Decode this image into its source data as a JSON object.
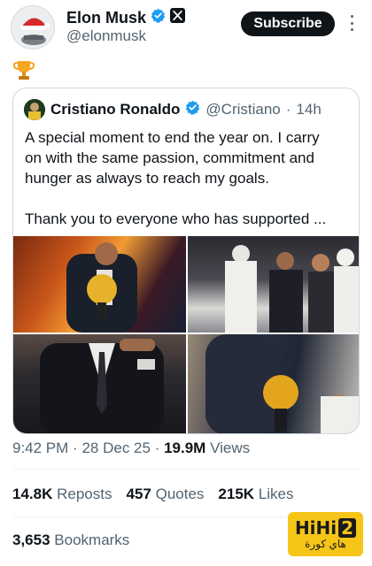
{
  "post": {
    "author_name": "Elon Musk",
    "author_handle": "@elonmusk",
    "subscribe_label": "Subscribe",
    "body_emoji": "trophy-icon"
  },
  "quote": {
    "author_name": "Cristiano Ronaldo",
    "author_handle": "@Cristiano",
    "separator": "·",
    "time": "14h",
    "text_lines": [
      "A special moment to end the year on. I carry",
      "on with the same passion, commitment and",
      "hunger as always to reach my goals.",
      "",
      "Thank you to everyone who has supported ..."
    ]
  },
  "meta": {
    "time": "9:42 PM",
    "date": "28 Dec 25",
    "separator": "·",
    "views_count": "19.9M",
    "views_label": "Views"
  },
  "stats": {
    "reposts_count": "14.8K",
    "reposts_label": "Reposts",
    "quotes_count": "457",
    "quotes_label": "Quotes",
    "likes_count": "215K",
    "likes_label": "Likes",
    "bookmarks_count": "3,653",
    "bookmarks_label": "Bookmarks"
  },
  "watermark": {
    "logo_text": "HiHi",
    "logo_num": "2",
    "arabic": "هاي كورة"
  },
  "colors": {
    "verified": "#1d9bf0",
    "text": "#0f1419",
    "muted": "#536471",
    "border": "#cfd9de",
    "watermark_bg": "#f5c518"
  }
}
